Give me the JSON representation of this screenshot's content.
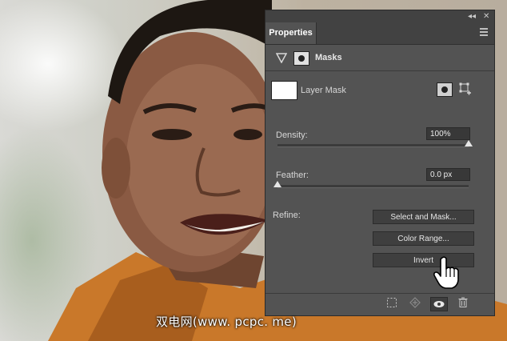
{
  "panel": {
    "tab_label": "Properties",
    "collapse_icon": "double-chevron-left-icon",
    "close_icon": "close-icon",
    "menu_icon": "panel-menu-icon"
  },
  "masks": {
    "section_label": "Masks",
    "layer_mask_label": "Layer Mask"
  },
  "density": {
    "label": "Density:",
    "value_text": "100%",
    "level": 1.0
  },
  "feather": {
    "label": "Feather:",
    "value_text": "0.0 px",
    "level": 0.0
  },
  "refine": {
    "label": "Refine:",
    "buttons": [
      "Select and Mask...",
      "Color Range...",
      "Invert"
    ]
  },
  "footer_icons": [
    "load-selection-icon",
    "apply-mask-icon",
    "visibility-eye-icon",
    "trash-icon"
  ],
  "watermark": "双电网(www. pcpc. me)",
  "colors": {
    "panel_bg": "#535353",
    "tab_bar_bg": "#424242",
    "button_bg": "#3f3f3f",
    "input_bg": "#383838"
  }
}
